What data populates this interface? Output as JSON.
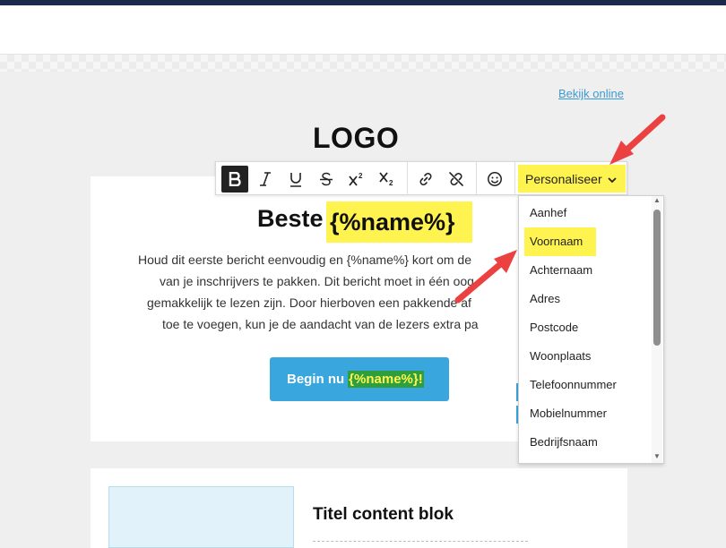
{
  "header": {
    "view_online": "Bekijk online",
    "logo": "LOGO"
  },
  "toolbar": {
    "items": [
      "bold-icon",
      "italic-icon",
      "underline-icon",
      "strikethrough-icon",
      "superscript-icon",
      "subscript-icon",
      "link-icon",
      "unlink-icon",
      "emoji-icon"
    ],
    "personalize_label": "Personaliseer",
    "personalize_color": "#fff44f"
  },
  "email": {
    "headline_text": "Beste",
    "headline_variable": "{%name%}",
    "body_lines": [
      "Houd dit eerste bericht eenvoudig en {%name%} kort om de",
      "van je inschrijvers te pakken. Dit bericht moet in één oog",
      "gemakkelijk te lezen zijn. Door hierboven een pakkende af",
      "toe te voegen, kun je de aandacht van de lezers extra pa"
    ],
    "cta_label": "Begin nu",
    "cta_variable": "{%name%}!",
    "cta_color": "#3aa6de",
    "content_block_title": "Titel content blok"
  },
  "dropdown": {
    "items": [
      "Aanhef",
      "Voornaam",
      "Achternaam",
      "Adres",
      "Postcode",
      "Woonplaats",
      "Telefoonnummer",
      "Mobielnummer",
      "Bedrijfsnaam"
    ],
    "selected": "Voornaam"
  },
  "annotation_color": "#ec4141"
}
